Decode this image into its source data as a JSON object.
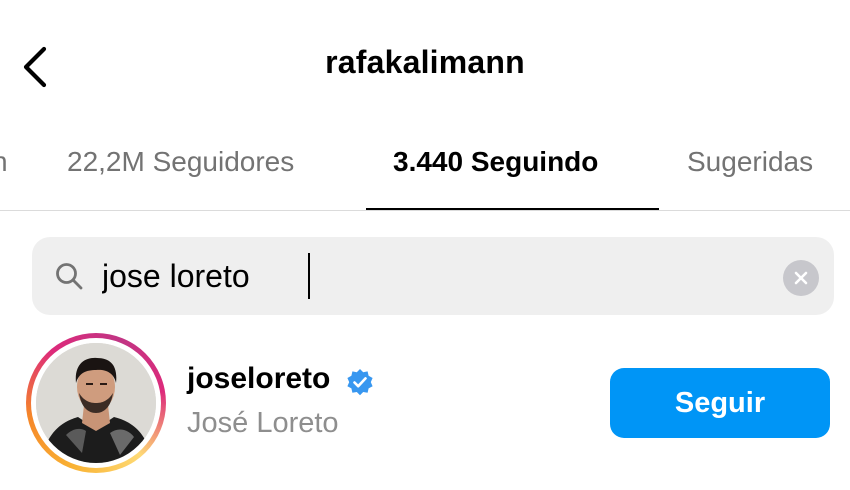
{
  "header": {
    "title": "rafakalimann",
    "back_icon": "chevron-left-icon"
  },
  "tabs": [
    {
      "label": "n",
      "active": false
    },
    {
      "label": "22,2M Seguidores",
      "active": false
    },
    {
      "label": "3.440 Seguindo",
      "active": true
    },
    {
      "label": "Sugeridas",
      "active": false
    }
  ],
  "search": {
    "value": "jose loreto",
    "icon": "search-icon",
    "clear_icon": "clear-icon"
  },
  "results": [
    {
      "username": "joseloreto",
      "full_name": "José Loreto",
      "verified": true,
      "has_story_ring": true,
      "button_label": "Seguir"
    }
  ],
  "colors": {
    "accent": "#0095f6",
    "verified_badge": "#3897f0",
    "muted_text": "#737373",
    "search_bg": "#efefef"
  }
}
